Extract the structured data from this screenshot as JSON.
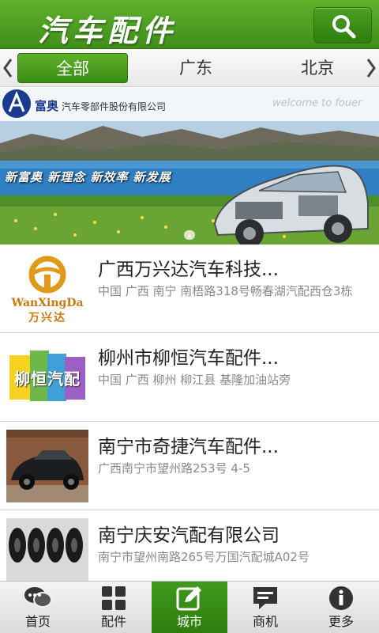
{
  "header": {
    "title": "汽车配件",
    "search_icon": "search-icon"
  },
  "tabs": {
    "items": [
      {
        "label": "全部",
        "selected": true
      },
      {
        "label": "广东",
        "selected": false
      },
      {
        "label": "北京",
        "selected": false
      }
    ],
    "left_icon": "chevron-left-icon",
    "right_icon": "chevron-right-icon"
  },
  "banner": {
    "brand": "富奥",
    "company": "汽车零部件股份有限公司",
    "welcome": "welcome to fouer",
    "slogan": "新富奥 新理念 新效率 新发展",
    "active_slide": 1
  },
  "list": {
    "items": [
      {
        "title": "广西万兴达汽车科技...",
        "address": "中国 广西 南宁 南梧路318号畅春湖汽配西仓3栋",
        "logo_text": "WanXingDa",
        "logo_sub": "万兴达"
      },
      {
        "title": "柳州市柳恒汽车配件...",
        "address": "中国 广西 柳州 柳江县 基隆加油站旁",
        "logo_text": "柳恒汽配"
      },
      {
        "title": "南宁市奇捷汽车配件...",
        "address": "广西南宁市望州路253号 4-5"
      },
      {
        "title": "南宁庆安汽配有限公司",
        "address": "南宁市望州南路265号万国汽配城A02号"
      }
    ]
  },
  "bottomnav": {
    "items": [
      {
        "label": "首页",
        "icon": "chat-bubbles-icon"
      },
      {
        "label": "配件",
        "icon": "grid-icon"
      },
      {
        "label": "城市",
        "icon": "edit-icon",
        "active": true
      },
      {
        "label": "商机",
        "icon": "message-icon"
      },
      {
        "label": "更多",
        "icon": "info-icon"
      }
    ]
  },
  "colors": {
    "brand_green": "#4aa01f",
    "dark_green": "#2f7d10",
    "text_gray": "#8a8a8a"
  }
}
